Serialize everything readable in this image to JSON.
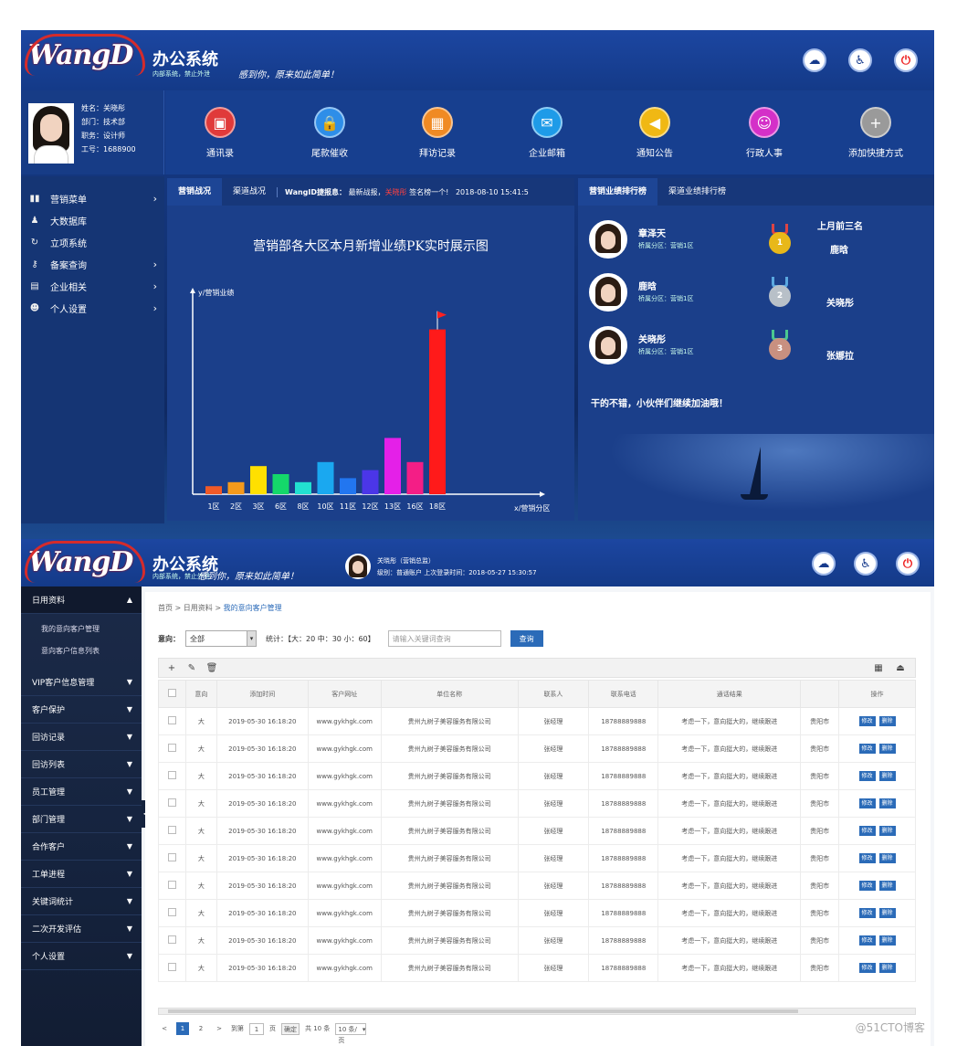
{
  "top": {
    "logo": "WangD",
    "brand": "办公系统",
    "brand_sub": "内部系统，禁止外泄",
    "slogan": "感到你，原来如此简单！",
    "header_icons": [
      "cloud-icon",
      "user-icon",
      "power-icon"
    ],
    "user": {
      "name": "姓名：关晓彤",
      "dept": "部门：技术部",
      "role": "职务：设计师",
      "id": "工号：1688900"
    },
    "quick": [
      {
        "label": "通讯录",
        "icon": "contacts-icon",
        "color": "#e03a3a"
      },
      {
        "label": "尾款催收",
        "icon": "lock-icon",
        "color": "#2e8ee8"
      },
      {
        "label": "拜访记录",
        "icon": "calendar-icon",
        "color": "#f08a24"
      },
      {
        "label": "企业邮箱",
        "icon": "mail-icon",
        "color": "#1e9be8"
      },
      {
        "label": "通知公告",
        "icon": "megaphone-icon",
        "color": "#f0b814"
      },
      {
        "label": "行政人事",
        "icon": "people-icon",
        "color": "#d430c8"
      },
      {
        "label": "添加快捷方式",
        "icon": "plus-icon",
        "color": "#9a9a9a"
      }
    ],
    "sidebar": [
      {
        "label": "营销菜单",
        "icon": "bar-chart-icon",
        "arrow": true
      },
      {
        "label": "大数据库",
        "icon": "users-icon",
        "arrow": false
      },
      {
        "label": "立项系统",
        "icon": "refresh-icon",
        "arrow": false
      },
      {
        "label": "备案查询",
        "icon": "key-icon",
        "arrow": true
      },
      {
        "label": "企业相关",
        "icon": "book-icon",
        "arrow": true
      },
      {
        "label": "个人设置",
        "icon": "person-icon",
        "arrow": true
      }
    ],
    "chart_tabs": {
      "tab1": "营销战况",
      "tab2": "渠道战况",
      "ticker_brand": "WangID捷报息：",
      "ticker_text": "最新战报，",
      "ticker_hl": "关晓彤",
      "ticker_tail": "签名榜一个!",
      "ticker_time": "2018-08-10 15:41:5"
    },
    "rank_tabs": {
      "tab1": "营销业绩排行榜",
      "tab2": "渠道业绩排行榜"
    },
    "ranking": [
      {
        "name": "章泽天",
        "sub": "桥属分区：营销1区",
        "medal": "gold",
        "rank_label": "1"
      },
      {
        "name": "鹿晗",
        "sub": "桥属分区：营销1区",
        "medal": "silver",
        "rank_label": "2"
      },
      {
        "name": "关晓彤",
        "sub": "桥属分区：营销1区",
        "medal": "bronze",
        "rank_label": "3"
      }
    ],
    "last_month_title": "上月前三名",
    "last_month": [
      "鹿晗",
      "关晓彤",
      "张娜拉"
    ],
    "rank_message": "干的不错，小伙伴们继续加油哦！"
  },
  "chart_data": {
    "type": "bar",
    "title": "营销部各大区本月新增业绩PK实时展示图",
    "ylabel": "y/营销业绩",
    "xlabel": "x/营销分区",
    "categories": [
      "1区",
      "2区",
      "3区",
      "6区",
      "8区",
      "10区",
      "11区",
      "12区",
      "13区",
      "16区",
      "18区"
    ],
    "values": [
      4,
      6,
      14,
      10,
      6,
      16,
      8,
      12,
      28,
      16,
      82
    ],
    "colors": [
      "#f05a28",
      "#f49a1c",
      "#ffe000",
      "#14d86a",
      "#22e0d0",
      "#1aa8f0",
      "#2276f0",
      "#4b36e8",
      "#e420e8",
      "#f41e86",
      "#ff1a1a"
    ],
    "ylim": [
      0,
      100
    ],
    "flag_on": "18区",
    "grid": false
  },
  "bottom": {
    "logo": "WangD",
    "brand": "办公系统",
    "brand_sub": "内部系统，禁止外泄",
    "slogan": "感到你，原来如此简单！",
    "user_line1": "关晓彤（营销总监）",
    "user_line2": "级别：普通账户 上次登录时间：2018-05-27 15:30:57",
    "header_icons": [
      "cloud-icon",
      "user-icon",
      "power-icon"
    ],
    "sidebar": [
      {
        "label": "日用资料",
        "arrow": "▲"
      },
      {
        "label": "我的意向客户管理",
        "sub": true
      },
      {
        "label": "意向客户信息列表",
        "sub": true
      },
      {
        "label": "VIP客户信息管理",
        "arrow": "▼"
      },
      {
        "label": "客户保护",
        "arrow": "▼"
      },
      {
        "label": "回访记录",
        "arrow": "▼"
      },
      {
        "label": "回访列表",
        "arrow": "▼"
      },
      {
        "label": "员工管理",
        "arrow": "▼"
      },
      {
        "label": "部门管理",
        "arrow": "▼"
      },
      {
        "label": "合作客户",
        "arrow": "▼"
      },
      {
        "label": "工单进程",
        "arrow": "▼"
      },
      {
        "label": "关键词统计",
        "arrow": "▼"
      },
      {
        "label": "二次开发评估",
        "arrow": "▼"
      },
      {
        "label": "个人设置",
        "arrow": "▼"
      }
    ],
    "breadcrumb": {
      "home": "首页",
      "sep": ">",
      "mid": "日用资料",
      "cur": "我的意向客户管理"
    },
    "filter": {
      "intent_label": "意向：",
      "intent_value": "全部",
      "stats": "统计：【大：20 中：30 小：60】",
      "search_placeholder": "请输入关键词查询",
      "search_button": "查询"
    },
    "toolbar": {
      "add": "+",
      "edit": "✎",
      "delete": "🗑",
      "grid": "▦",
      "export": "⏏"
    },
    "columns": [
      "",
      "意向",
      "添加时间",
      "客户网址",
      "单位名称",
      "联系人",
      "联系电话",
      "通话结果",
      "",
      "操作"
    ],
    "rows": [
      [
        "大",
        "2019-05-30 16:18:20",
        "www.gykhgk.com",
        "贵州九树子美容服务有限公司",
        "张经理",
        "18788889888",
        "考虑一下，意向挺大的，继续跟进",
        "贵阳市"
      ],
      [
        "大",
        "2019-05-30 16:18:20",
        "www.gykhgk.com",
        "贵州九树子美容服务有限公司",
        "张经理",
        "18788889888",
        "考虑一下，意向挺大的，继续跟进",
        "贵阳市"
      ],
      [
        "大",
        "2019-05-30 16:18:20",
        "www.gykhgk.com",
        "贵州九树子美容服务有限公司",
        "张经理",
        "18788889888",
        "考虑一下，意向挺大的，继续跟进",
        "贵阳市"
      ],
      [
        "大",
        "2019-05-30 16:18:20",
        "www.gykhgk.com",
        "贵州九树子美容服务有限公司",
        "张经理",
        "18788889888",
        "考虑一下，意向挺大的，继续跟进",
        "贵阳市"
      ],
      [
        "大",
        "2019-05-30 16:18:20",
        "www.gykhgk.com",
        "贵州九树子美容服务有限公司",
        "张经理",
        "18788889888",
        "考虑一下，意向挺大的，继续跟进",
        "贵阳市"
      ],
      [
        "大",
        "2019-05-30 16:18:20",
        "www.gykhgk.com",
        "贵州九树子美容服务有限公司",
        "张经理",
        "18788889888",
        "考虑一下，意向挺大的，继续跟进",
        "贵阳市"
      ],
      [
        "大",
        "2019-05-30 16:18:20",
        "www.gykhgk.com",
        "贵州九树子美容服务有限公司",
        "张经理",
        "18788889888",
        "考虑一下，意向挺大的，继续跟进",
        "贵阳市"
      ],
      [
        "大",
        "2019-05-30 16:18:20",
        "www.gykhgk.com",
        "贵州九树子美容服务有限公司",
        "张经理",
        "18788889888",
        "考虑一下，意向挺大的，继续跟进",
        "贵阳市"
      ],
      [
        "大",
        "2019-05-30 16:18:20",
        "www.gykhgk.com",
        "贵州九树子美容服务有限公司",
        "张经理",
        "18788889888",
        "考虑一下，意向挺大的，继续跟进",
        "贵阳市"
      ],
      [
        "大",
        "2019-05-30 16:18:20",
        "www.gykhgk.com",
        "贵州九树子美容服务有限公司",
        "张经理",
        "18788889888",
        "考虑一下，意向挺大的，继续跟进",
        "贵阳市"
      ]
    ],
    "row_edit": "修改",
    "row_delete": "删除",
    "pager": {
      "prev": "<",
      "p1": "1",
      "p2": "2",
      "next": ">",
      "goto": "到第",
      "page_value": "1",
      "page_unit": "页",
      "confirm": "确定",
      "total": "共 10 条",
      "per_page": "10 条/页"
    },
    "watermark": "@51CTO博客"
  }
}
